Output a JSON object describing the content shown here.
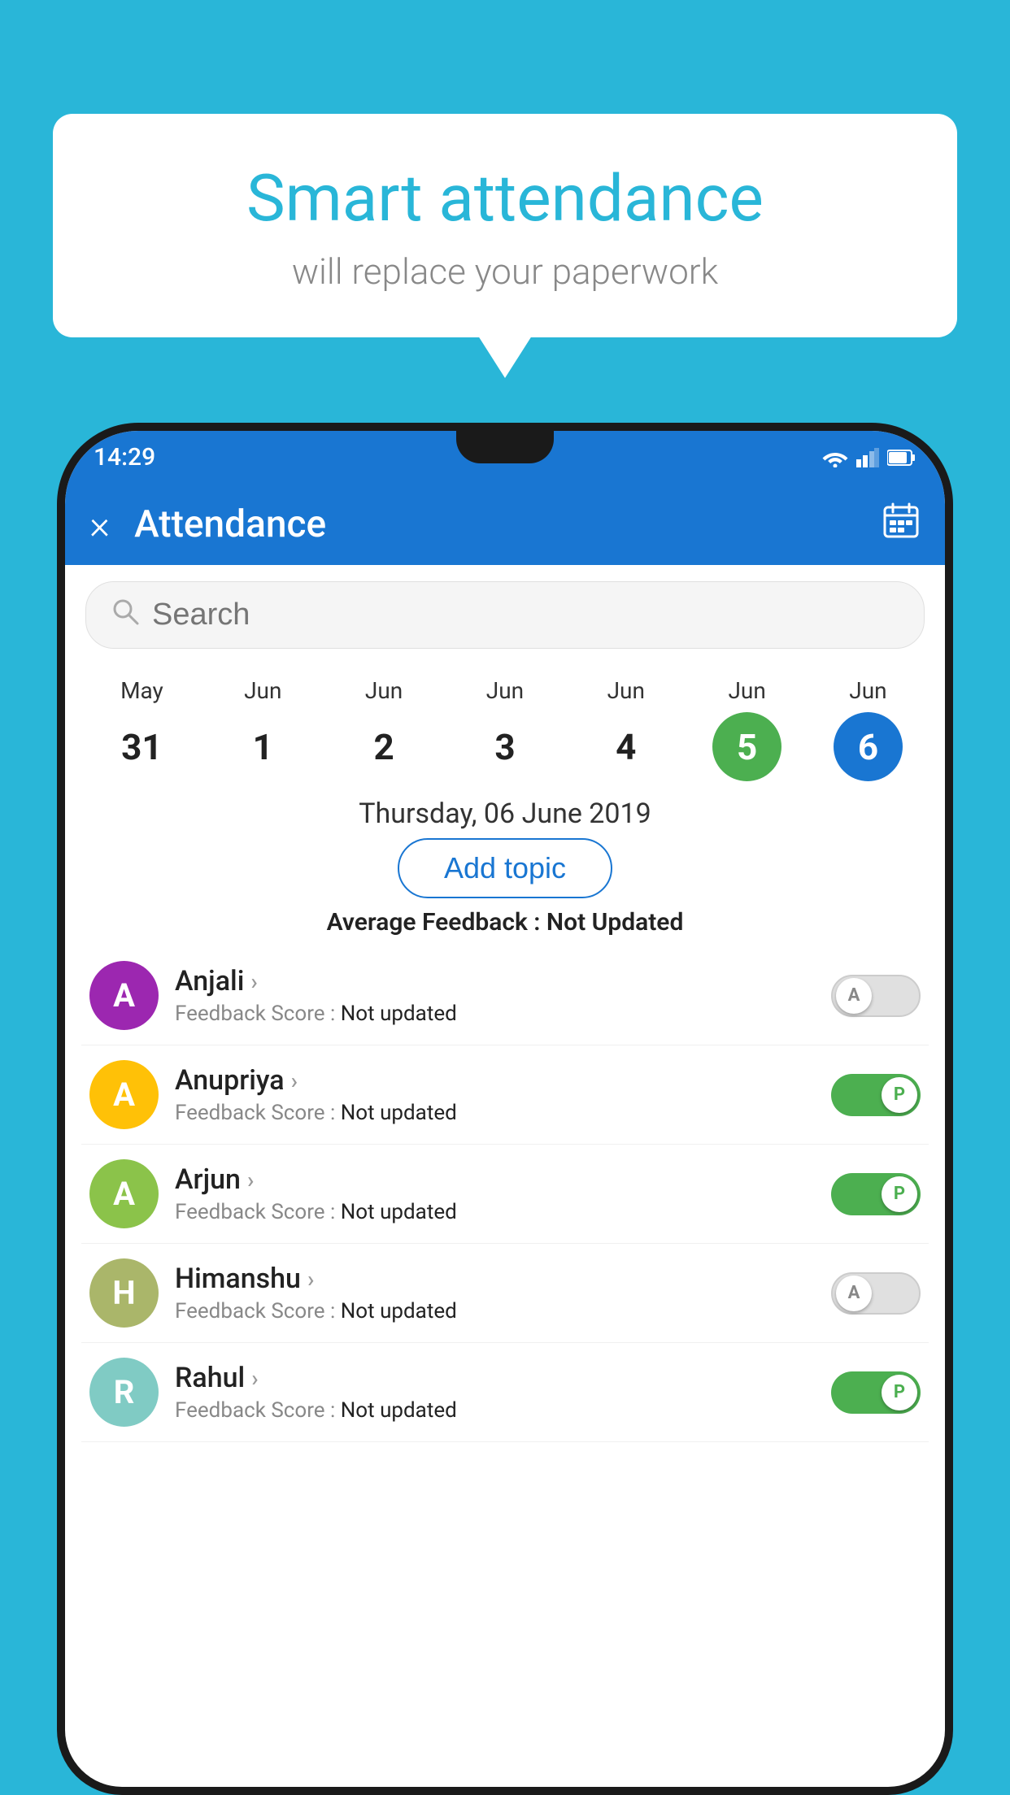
{
  "background_color": "#29b6d8",
  "speech_bubble": {
    "title": "Smart attendance",
    "subtitle": "will replace your paperwork"
  },
  "status_bar": {
    "time": "14:29"
  },
  "app_bar": {
    "title": "Attendance",
    "close_label": "×"
  },
  "search": {
    "placeholder": "Search"
  },
  "calendar": {
    "days": [
      {
        "month": "May",
        "date": "31",
        "style": "normal"
      },
      {
        "month": "Jun",
        "date": "1",
        "style": "normal"
      },
      {
        "month": "Jun",
        "date": "2",
        "style": "normal"
      },
      {
        "month": "Jun",
        "date": "3",
        "style": "normal"
      },
      {
        "month": "Jun",
        "date": "4",
        "style": "normal"
      },
      {
        "month": "Jun",
        "date": "5",
        "style": "active-green"
      },
      {
        "month": "Jun",
        "date": "6",
        "style": "active-blue"
      }
    ],
    "selected_date": "Thursday, 06 June 2019"
  },
  "add_topic_label": "Add topic",
  "avg_feedback": {
    "label": "Average Feedback : ",
    "value": "Not Updated"
  },
  "students": [
    {
      "name": "Anjali",
      "initial": "A",
      "avatar_color": "purple",
      "feedback_label": "Feedback Score : ",
      "feedback_value": "Not updated",
      "toggle": "off",
      "toggle_label": "A"
    },
    {
      "name": "Anupriya",
      "initial": "A",
      "avatar_color": "yellow",
      "feedback_label": "Feedback Score : ",
      "feedback_value": "Not updated",
      "toggle": "on",
      "toggle_label": "P"
    },
    {
      "name": "Arjun",
      "initial": "A",
      "avatar_color": "green",
      "feedback_label": "Feedback Score : ",
      "feedback_value": "Not updated",
      "toggle": "on",
      "toggle_label": "P"
    },
    {
      "name": "Himanshu",
      "initial": "H",
      "avatar_color": "olive",
      "feedback_label": "Feedback Score : ",
      "feedback_value": "Not updated",
      "toggle": "off",
      "toggle_label": "A"
    },
    {
      "name": "Rahul",
      "initial": "R",
      "avatar_color": "teal",
      "feedback_label": "Feedback Score : ",
      "feedback_value": "Not updated",
      "toggle": "on",
      "toggle_label": "P"
    }
  ]
}
